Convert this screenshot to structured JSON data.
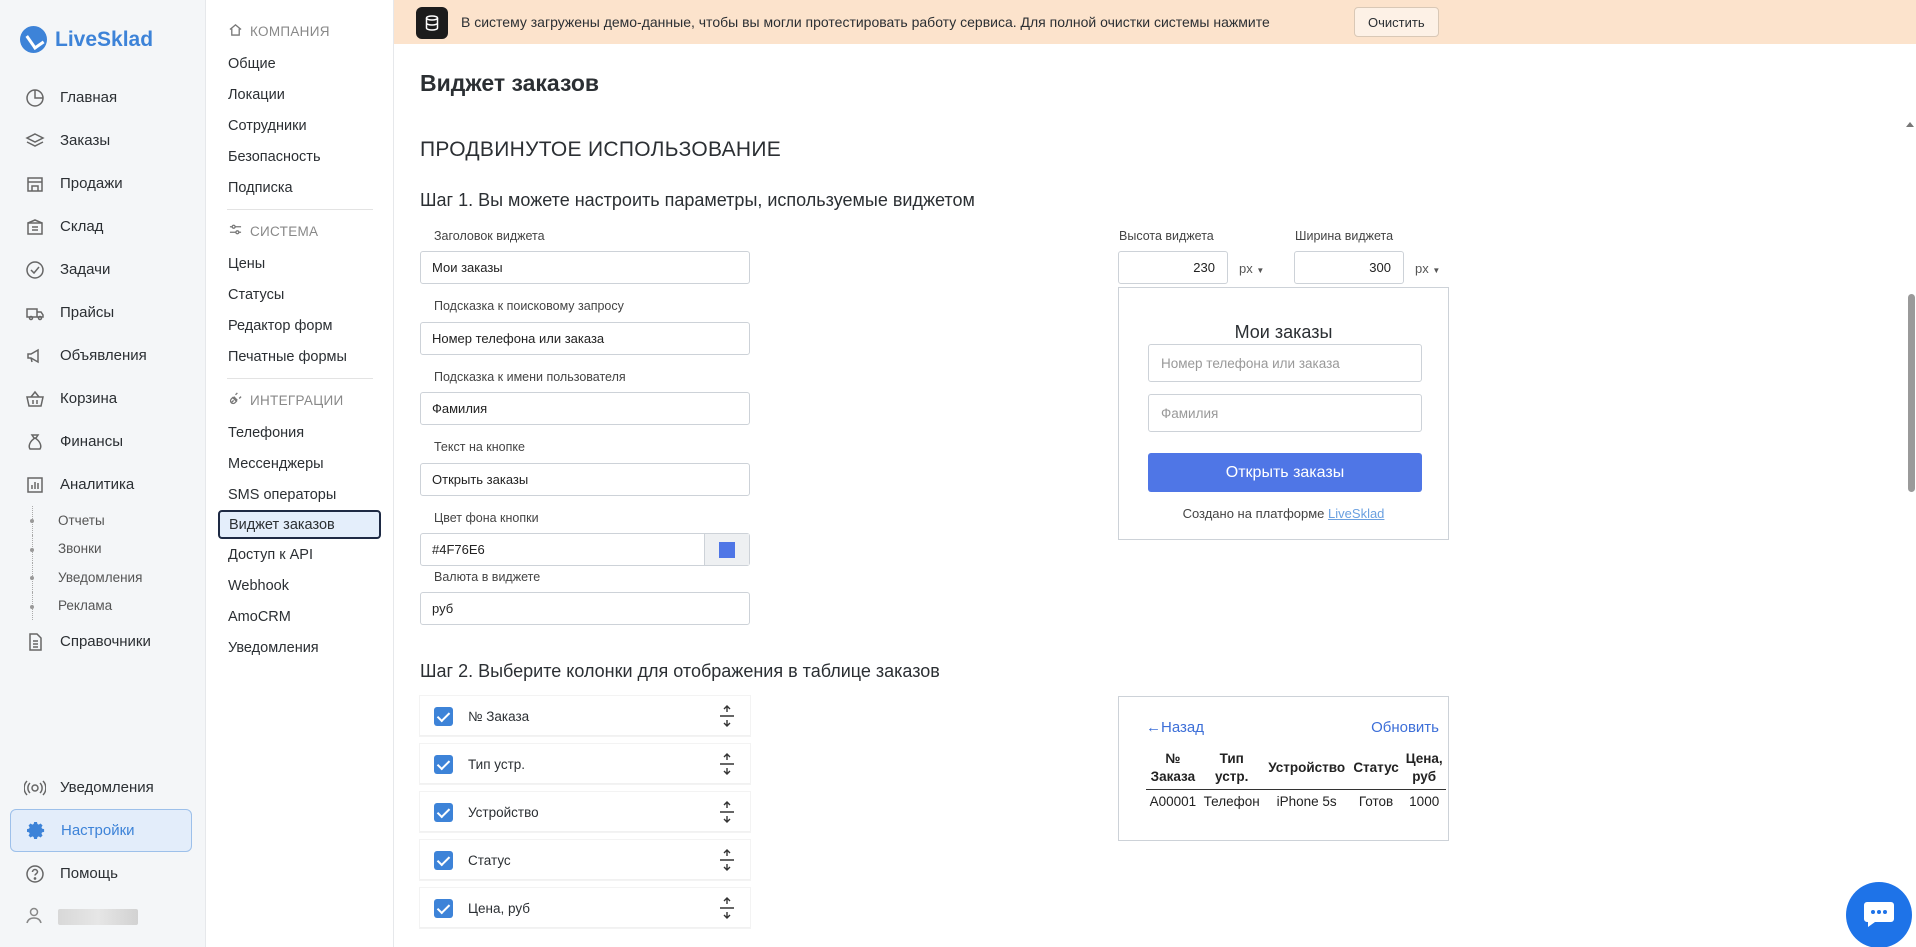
{
  "brand": {
    "name": "LiveSklad",
    "accent": "#3d83d8"
  },
  "nav": {
    "items": [
      {
        "label": "Главная",
        "icon": "dashboard-icon"
      },
      {
        "label": "Заказы",
        "icon": "layers-icon"
      },
      {
        "label": "Продажи",
        "icon": "store-icon"
      },
      {
        "label": "Склад",
        "icon": "warehouse-icon"
      },
      {
        "label": "Задачи",
        "icon": "check-circle-icon"
      },
      {
        "label": "Прайсы",
        "icon": "truck-icon"
      },
      {
        "label": "Объявления",
        "icon": "megaphone-icon"
      },
      {
        "label": "Корзина",
        "icon": "basket-icon"
      },
      {
        "label": "Финансы",
        "icon": "money-bag-icon"
      },
      {
        "label": "Аналитика",
        "icon": "bar-chart-icon"
      }
    ],
    "analytics_sub": [
      "Отчеты",
      "Звонки",
      "Уведомления",
      "Реклама"
    ],
    "references": "Справочники",
    "bottom": {
      "notifications": "Уведомления",
      "settings": "Настройки",
      "help": "Помощь"
    }
  },
  "submenu": {
    "company": {
      "title": "КОМПАНИЯ",
      "items": [
        "Общие",
        "Локации",
        "Сотрудники",
        "Безопасность",
        "Подписка"
      ]
    },
    "system": {
      "title": "СИСТЕМА",
      "items": [
        "Цены",
        "Статусы",
        "Редактор форм",
        "Печатные формы"
      ]
    },
    "integrations": {
      "title": "ИНТЕГРАЦИИ",
      "items": [
        "Телефония",
        "Мессенджеры",
        "SMS операторы",
        "Виджет заказов",
        "Доступ к API",
        "Webhook",
        "AmoCRM",
        "Уведомления"
      ]
    }
  },
  "banner": {
    "text": "В систему загружены демо-данные, чтобы вы могли протестировать работу сервиса. Для полной очистки системы нажмите",
    "button": "Очистить"
  },
  "page": {
    "title": "Виджет заказов",
    "section": "ПРОДВИНУТОЕ ИСПОЛЬЗОВАНИЕ",
    "step1": "Шаг 1. Вы можете настроить параметры, используемые виджетом",
    "step2": "Шаг 2. Выберите колонки для отображения в таблице заказов"
  },
  "form": {
    "widget_title_label": "Заголовок виджета",
    "widget_title_value": "Мои заказы",
    "search_hint_label": "Подсказка к поисковому запросу",
    "search_hint_value": "Номер телефона или заказа",
    "name_hint_label": "Подсказка к имени пользователя",
    "name_hint_value": "Фамилия",
    "button_text_label": "Текст на кнопке",
    "button_text_value": "Открыть заказы",
    "button_color_label": "Цвет фона кнопки",
    "button_color_value": "#4F76E6",
    "currency_label": "Валюта в виджете",
    "currency_value": "руб"
  },
  "dimensions": {
    "height_label": "Высота виджета",
    "height_value": "230",
    "width_label": "Ширина виджета",
    "width_value": "300",
    "unit": "px"
  },
  "preview": {
    "title": "Мои заказы",
    "search_placeholder": "Номер телефона или заказа",
    "name_placeholder": "Фамилия",
    "button": "Открыть заказы",
    "credit_prefix": "Создано на платформе",
    "credit_link": "LiveSklad"
  },
  "columns": [
    "№ Заказа",
    "Тип устр.",
    "Устройство",
    "Статус",
    "Цена, руб"
  ],
  "table_preview": {
    "back": "←Назад",
    "refresh": "Обновить",
    "headers": [
      [
        "№",
        "Заказа"
      ],
      [
        "Тип",
        "устр."
      ],
      [
        "Устройство"
      ],
      [
        "Статус"
      ],
      [
        "Цена,",
        "руб"
      ]
    ],
    "row": [
      "A00001",
      "Телефон",
      "iPhone 5s",
      "Готов",
      "1000"
    ]
  }
}
